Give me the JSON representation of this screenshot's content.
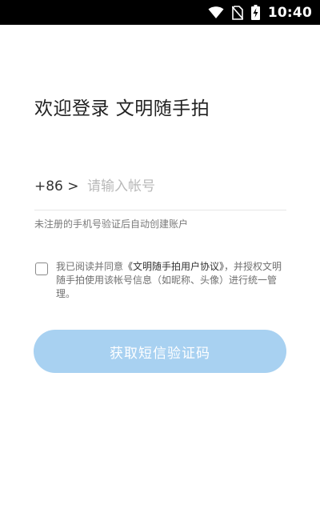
{
  "status_bar": {
    "time": "10:40",
    "icons": [
      "wifi-icon",
      "no-sim-icon",
      "battery-charging-icon"
    ]
  },
  "login": {
    "title": "欢迎登录 文明随手拍",
    "country_code": "+86 >",
    "phone_placeholder": "请输入帐号",
    "phone_value": "",
    "hint": "未注册的手机号验证后自动创建账户",
    "agreement": {
      "checked": false,
      "prefix": "我已阅读并同意",
      "link_text": "《文明随手拍用户协议》",
      "suffix": "，并授权文明随手拍使用该帐号信息（如昵称、头像）进行统一管理。"
    },
    "sms_button_label": "获取短信验证码"
  },
  "colors": {
    "button_bg": "#a8d1f1",
    "status_bar_bg": "#000000"
  }
}
